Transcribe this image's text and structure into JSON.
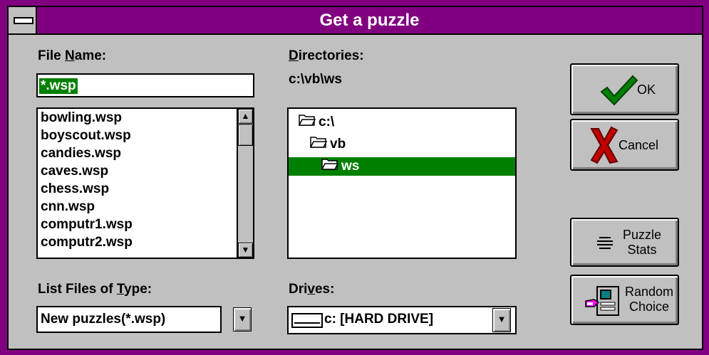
{
  "window": {
    "title": "Get a puzzle"
  },
  "file_name": {
    "label_prefix": "File ",
    "label_mnemonic": "N",
    "label_suffix": "ame:",
    "value": "*.wsp",
    "files": [
      "bowling.wsp",
      "boyscout.wsp",
      "candies.wsp",
      "caves.wsp",
      "chess.wsp",
      "cnn.wsp",
      "computr1.wsp",
      "computr2.wsp"
    ]
  },
  "directories": {
    "label_mnemonic": "D",
    "label_suffix": "irectories:",
    "current_path": "c:\\vb\\ws",
    "items": [
      {
        "name": "c:\\",
        "level": 0,
        "selected": false
      },
      {
        "name": "vb",
        "level": 1,
        "selected": false
      },
      {
        "name": "ws",
        "level": 2,
        "selected": true
      }
    ]
  },
  "file_type": {
    "label_prefix": "List Files of ",
    "label_mnemonic": "T",
    "label_suffix": "ype:",
    "value": "New puzzles(*.wsp)"
  },
  "drives": {
    "label_prefix": "Dri",
    "label_mnemonic": "v",
    "label_suffix": "es:",
    "value": "c: [HARD DRIVE]"
  },
  "buttons": {
    "ok": "OK",
    "cancel": "Cancel",
    "puzzle_stats_line1": "Puzzle",
    "puzzle_stats_line2": "Stats",
    "random_line1": "Random",
    "random_line2": "Choice"
  },
  "icons": {
    "ok": "checkmark-icon",
    "cancel": "x-icon",
    "stats": "lines-icon",
    "random": "computer-icon",
    "folder": "folder-icon",
    "scroll_up": "up-arrow-icon",
    "scroll_down": "down-arrow-icon",
    "dropdown": "down-arrow-icon"
  },
  "colors": {
    "title_bar": "#800080",
    "selection": "#008000",
    "face": "#c0c0c0",
    "ok_check": "#008000",
    "cancel_x": "#c00000"
  }
}
